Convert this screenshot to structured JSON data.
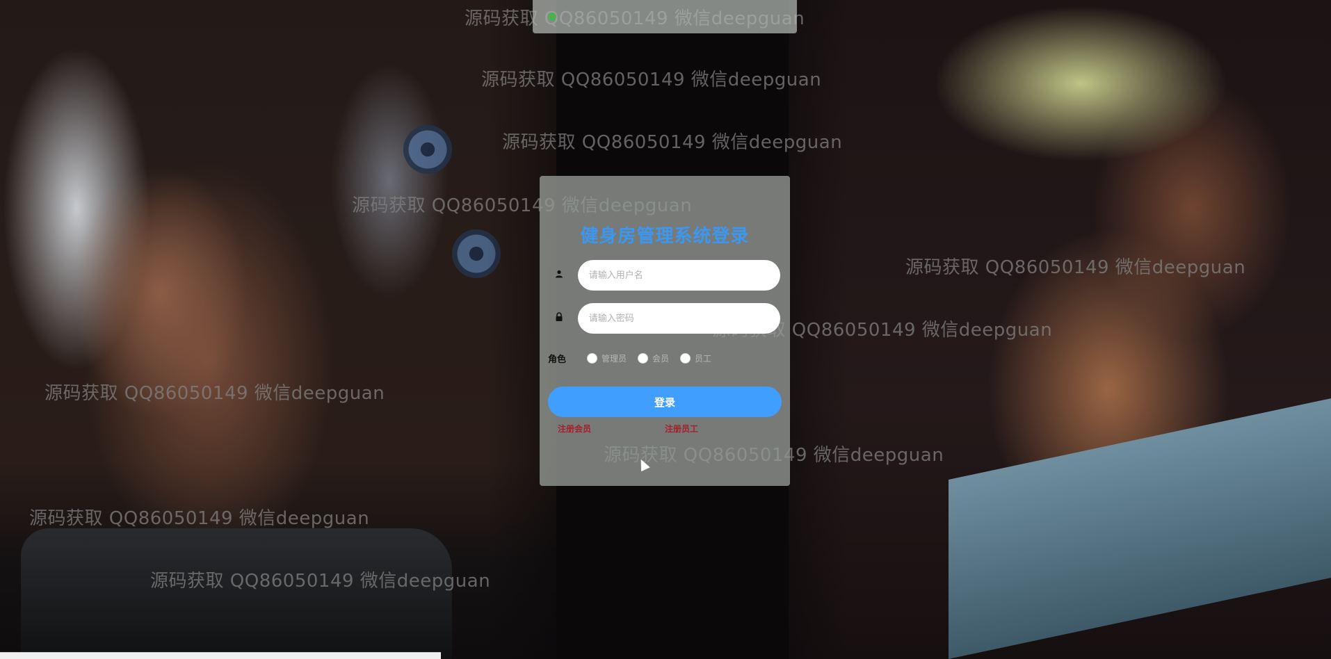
{
  "top_bar": {
    "text": ""
  },
  "login": {
    "title": "健身房管理系统登录",
    "username_placeholder": "请输入用户名",
    "password_placeholder": "请输入密码",
    "role_label": "角色",
    "roles": [
      "管理员",
      "会员",
      "员工"
    ],
    "login_button": "登录",
    "register_member": "注册会员",
    "register_staff": "注册员工"
  },
  "watermark": {
    "text": "源码获取 QQ86050149 微信deepguan"
  },
  "icons": {
    "user": "user-icon",
    "lock": "lock-icon",
    "status": "green-dot-icon"
  },
  "colors": {
    "title": "#3b97f0",
    "button": "#409eff",
    "register_link": "#a4202a",
    "status_dot": "#4caf50"
  }
}
